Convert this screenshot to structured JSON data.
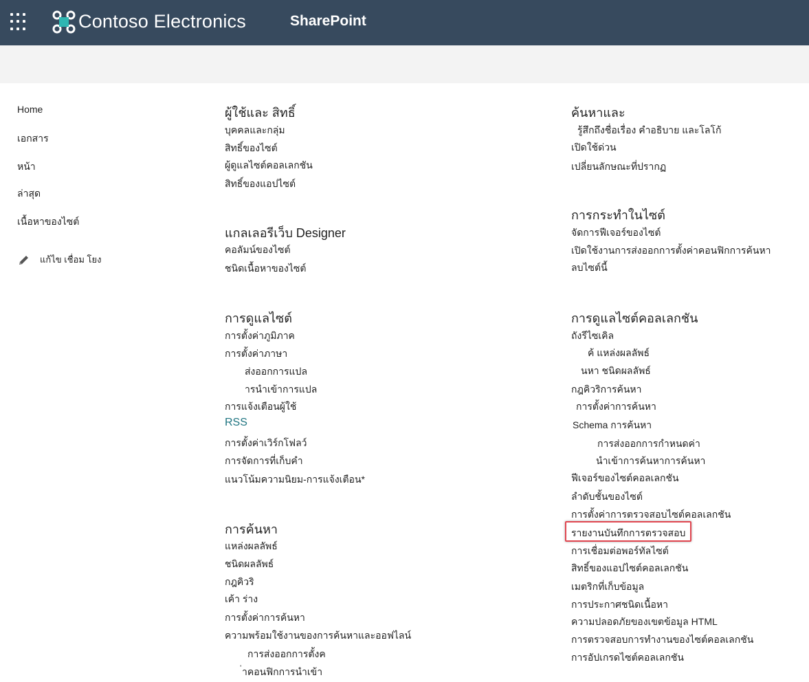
{
  "header": {
    "brand": "Contoso Electronics",
    "app_name": "SharePoint",
    "bg_color": "#374a5e",
    "logo_color": "#2fb6b2",
    "icons": [
      "app-launcher-icon",
      "contoso-logo-icon"
    ]
  },
  "left_nav": {
    "items": [
      "Home",
      "เอกสาร",
      "หน้า",
      "ล่าสุด",
      "เนื้อหาของไซต์"
    ],
    "edit_links": "แก้ไข เชื่อม โยง",
    "edit_icon": "pencil-icon"
  },
  "sections": {
    "users_permissions": {
      "title": "ผู้ใช้และ    สิทธิ์",
      "links": [
        "บุคคลและกลุ่ม",
        "สิทธิ์ของไซต์",
        "ผู้ดูแลไซต์คอลเลกชัน",
        "สิทธิ์ของแอปไซต์"
      ]
    },
    "designer_gallery": {
      "title": "แกลเลอรีเว็บ Designer",
      "links": [
        "คอลัมน์ของไซต์",
        "ชนิดเนื้อหาของไซต์"
      ]
    },
    "site_admin": {
      "title": "การดูแลไซต์",
      "links": [
        "การตั้งค่าภูมิภาค",
        "การตั้งค่าภาษา",
        "ส่งออกการแปล",
        "ารนำเข้าการแปล",
        "การแจ้งเตือนผู้ใช้",
        "RSS",
        "การตั้งค่าเวิร์กโฟลว์",
        "การจัดการที่เก็บคำ",
        "แนวโน้มความนิยม-การแจ้งเตือน*"
      ]
    },
    "search": {
      "title": "การค้นหา",
      "links": [
        "แหล่งผลลัพธ์",
        "ชนิดผลลัพธ์",
        "กฎคิวริ",
        "เค้า ร่าง",
        "การตั้งค่าการค้นหา",
        "ความพร้อมใช้งานของการค้นหาและออฟไลน์",
        "การส่งออกการตั้งค",
        "่าคอนฟิกการนำเข้า"
      ]
    },
    "look_feel": {
      "title": "ค้นหาและ",
      "links": [
        "รู้สึกถึงชื่อเรื่อง คำอธิบาย และโลโก้",
        "เปิดใช้ด่วน",
        "เปลี่ยนลักษณะที่ปรากฏ"
      ]
    },
    "site_actions": {
      "title": "การกระทำในไซต์",
      "links": [
        "จัดการฟีเจอร์ของไซต์",
        "เปิดใช้งานการส่งออกการตั้งค่าคอนฟิกการค้นหา",
        "ลบไซต์นี้"
      ]
    },
    "site_collection_admin": {
      "title": "การดูแลไซต์คอลเลกชัน",
      "links": [
        "ถังรีไซเคิล",
        "ค้    แหล่งผลลัพธ์",
        "นหา    ชนิดผลลัพธ์",
        "กฎคิวริการค้นหา",
        "การตั้งค่าการค้นหา",
        "Schema การค้นหา",
        "การส่งออกการกำหนดค่า",
        "นำเข้าการค้นหาการค้นหา",
        "ฟีเจอร์ของไซต์คอลเลกชัน",
        "ลำดับชั้นของไซต์",
        "การตั้งค่าการตรวจสอบไซต์คอลเลกชัน",
        "รายงานบันทึกการตรวจสอบ",
        "การเชื่อมต่อพอร์ทัลไซต์",
        "สิทธิ์ของแอปไซต์คอลเลกชัน",
        "เมตริกที่เก็บข้อมูล",
        "การประกาศชนิดเนื้อหา",
        "ความปลอดภัยของเขตข้อมูล HTML",
        "การตรวจสอบการทำงานของไซต์คอลเลกชัน",
        "การอัปเกรดไซต์คอลเลกชัน"
      ],
      "highlighted_link": "รายงานบันทึกการตรวจสอบ",
      "highlight_color": "#e0454f"
    }
  },
  "colors": {
    "link_accent": "#1e7480",
    "subbar": "#f3f3f3"
  }
}
